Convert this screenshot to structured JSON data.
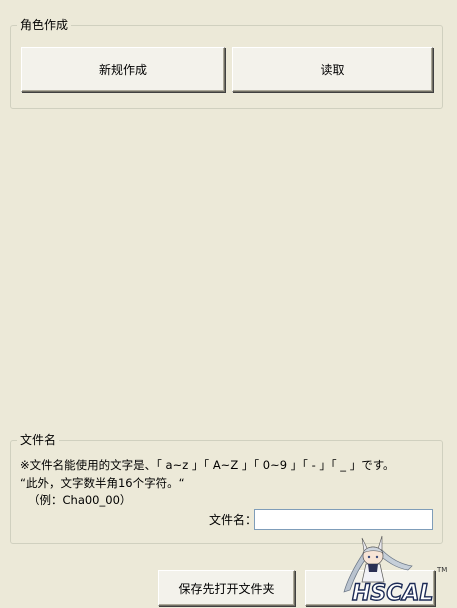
{
  "character_group": {
    "title": "角色作成",
    "new_button": "新规作成",
    "load_button": "读取"
  },
  "filename_group": {
    "title": "文件名",
    "note_line1": "※文件名能使用的文字是、「 a~z 」「 A~Z 」「 0~9 」「 - 」「 _ 」です。",
    "note_line2": "“此外，文字数半角16个字符。“",
    "note_line3": "（例：Cha00_00）",
    "field_label": "文件名：",
    "field_value": ""
  },
  "footer": {
    "open_folder_button": "保存先打开文件夹",
    "second_button": ""
  },
  "logo": {
    "text": "HSCAL",
    "tm": "TM"
  }
}
